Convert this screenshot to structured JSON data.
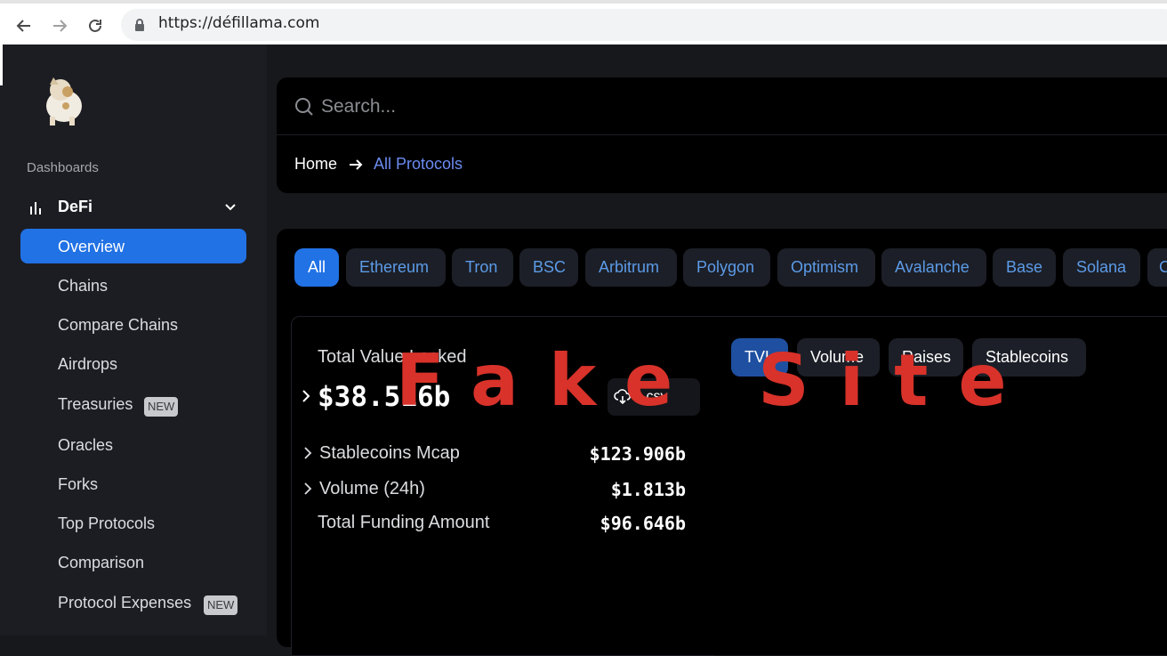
{
  "browser": {
    "url": "https://défillama.com",
    "back_icon": "arrow-left-icon",
    "forward_icon": "arrow-right-icon",
    "reload_icon": "reload-icon",
    "lock_icon": "lock-icon"
  },
  "sidebar": {
    "section_label": "Dashboards",
    "group": {
      "label": "DeFi",
      "icon": "bar-chart-icon",
      "chevron": "chevron-down-icon"
    },
    "items": [
      {
        "label": "Overview",
        "active": true
      },
      {
        "label": "Chains"
      },
      {
        "label": "Compare Chains"
      },
      {
        "label": "Airdrops"
      },
      {
        "label": "Treasuries",
        "badge": "NEW"
      },
      {
        "label": "Oracles"
      },
      {
        "label": "Forks"
      },
      {
        "label": "Top Protocols"
      },
      {
        "label": "Comparison"
      },
      {
        "label": "Protocol Expenses",
        "badge": "NEW"
      }
    ]
  },
  "search": {
    "placeholder": "Search..."
  },
  "breadcrumb": {
    "home": "Home",
    "current": "All Protocols"
  },
  "chains": [
    "All",
    "Ethereum",
    "Tron",
    "BSC",
    "Arbitrum",
    "Polygon",
    "Optimism",
    "Avalanche",
    "Base",
    "Solana",
    "C"
  ],
  "stats": {
    "tvl_label": "Total Value Locked",
    "tvl_value": "$38.516b",
    "csv_label": ".csv",
    "rows": [
      {
        "label": "Stablecoins Mcap",
        "value": "$123.906b"
      },
      {
        "label": "Volume (24h)",
        "value": "$1.813b"
      },
      {
        "label": "Total Funding Amount",
        "value": "$96.646b"
      }
    ]
  },
  "chart_tabs": [
    "TVL",
    "Volume",
    "Raises",
    "Stablecoins"
  ],
  "watermark": "Fake Site",
  "colors": {
    "accent": "#2172e5",
    "watermark": "#d8322a",
    "link": "#6b8bf0"
  }
}
